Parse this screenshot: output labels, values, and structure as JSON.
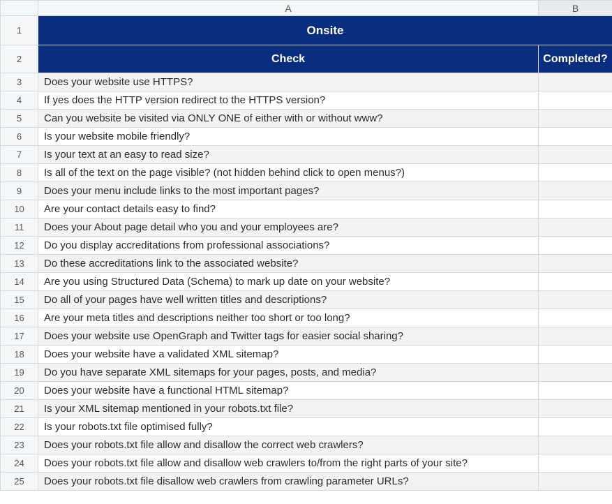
{
  "columns": {
    "a_letter": "A",
    "b_letter": "B"
  },
  "header": {
    "title": "Onsite",
    "check_label": "Check",
    "completed_label": "Completed?"
  },
  "rows": [
    {
      "num": 3,
      "check": "Does your website use HTTPS?",
      "completed": ""
    },
    {
      "num": 4,
      "check": "If yes does the HTTP version redirect to the HTTPS version?",
      "completed": ""
    },
    {
      "num": 5,
      "check": "Can you website be visited via ONLY ONE of either with or without www?",
      "completed": ""
    },
    {
      "num": 6,
      "check": "Is your website mobile friendly?",
      "completed": ""
    },
    {
      "num": 7,
      "check": "Is your text at an easy to read size?",
      "completed": ""
    },
    {
      "num": 8,
      "check": "Is all of the text on the page visible? (not hidden behind click to open menus?)",
      "completed": ""
    },
    {
      "num": 9,
      "check": "Does your menu include links to the most important pages?",
      "completed": ""
    },
    {
      "num": 10,
      "check": "Are your contact details easy to find?",
      "completed": ""
    },
    {
      "num": 11,
      "check": "Does your About page detail who you and your employees are?",
      "completed": ""
    },
    {
      "num": 12,
      "check": "Do you display accreditations from professional associations?",
      "completed": ""
    },
    {
      "num": 13,
      "check": "Do these accreditations link to the associated website?",
      "completed": ""
    },
    {
      "num": 14,
      "check": "Are you using Structured Data (Schema) to mark up date on your website?",
      "completed": ""
    },
    {
      "num": 15,
      "check": "Do all of your pages have well written titles and descriptions?",
      "completed": ""
    },
    {
      "num": 16,
      "check": "Are your meta titles and descriptions neither too short or too long?",
      "completed": ""
    },
    {
      "num": 17,
      "check": "Does your website use OpenGraph and Twitter tags for easier social sharing?",
      "completed": ""
    },
    {
      "num": 18,
      "check": "Does your website have a validated XML sitemap?",
      "completed": ""
    },
    {
      "num": 19,
      "check": "Do you have separate XML sitemaps for your pages, posts, and media?",
      "completed": ""
    },
    {
      "num": 20,
      "check": "Does your website have a functional HTML sitemap?",
      "completed": ""
    },
    {
      "num": 21,
      "check": "Is your XML sitemap mentioned in your robots.txt file?",
      "completed": ""
    },
    {
      "num": 22,
      "check": "Is your robots.txt file optimised fully?",
      "completed": ""
    },
    {
      "num": 23,
      "check": "Does your robots.txt file allow and disallow the correct web crawlers?",
      "completed": ""
    },
    {
      "num": 24,
      "check": "Does your robots.txt file allow and disallow web crawlers to/from the right parts of your site?",
      "completed": ""
    },
    {
      "num": 25,
      "check": "Does your robots.txt file disallow web crawlers from crawling parameter URLs?",
      "completed": ""
    }
  ]
}
